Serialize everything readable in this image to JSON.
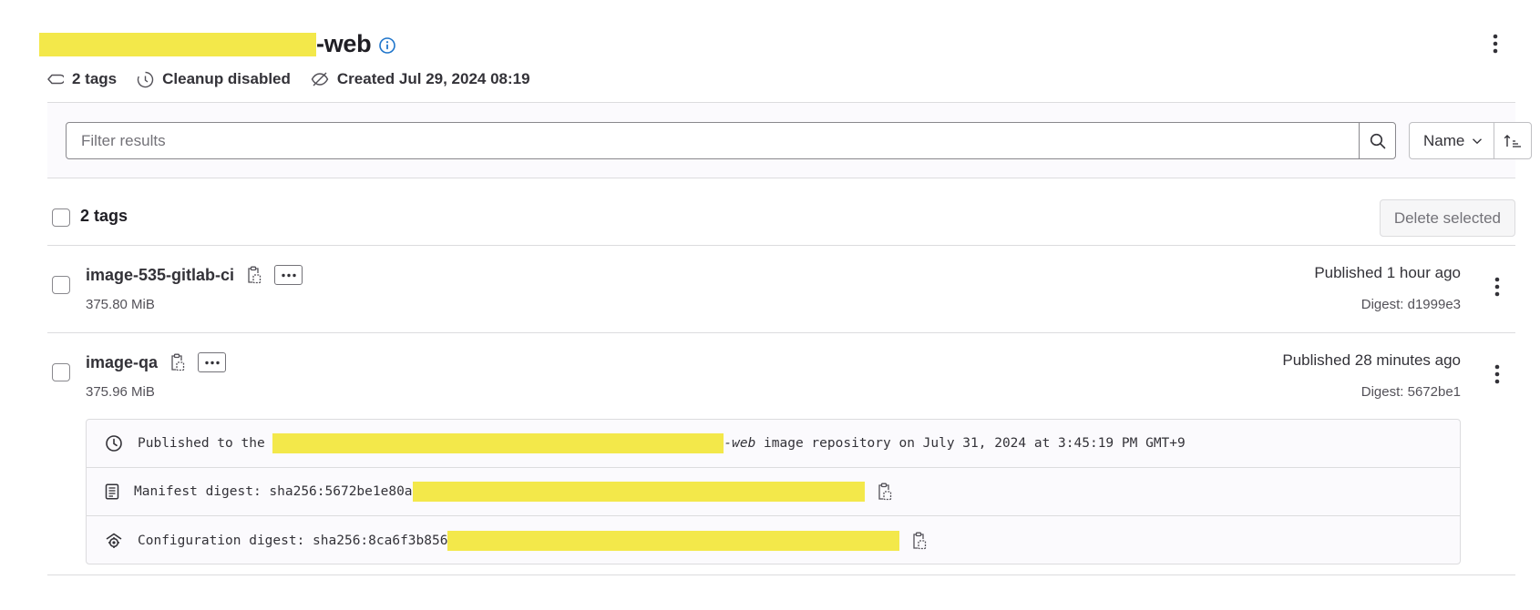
{
  "header": {
    "title_suffix": "-web",
    "meta": {
      "tags": "2 tags",
      "cleanup": "Cleanup disabled",
      "created": "Created Jul 29, 2024 08:19"
    }
  },
  "filter": {
    "placeholder": "Filter results",
    "sort_label": "Name"
  },
  "list": {
    "count_label": "2 tags",
    "delete_label": "Delete selected"
  },
  "tags": [
    {
      "name": "image-535-gitlab-ci",
      "size": "375.80 MiB",
      "published": "Published 1 hour ago",
      "digest": "Digest: d1999e3"
    },
    {
      "name": "image-qa",
      "size": "375.96 MiB",
      "published": "Published 28 minutes ago",
      "digest": "Digest: 5672be1",
      "details": {
        "published_prefix": "Published to the ",
        "published_repo_suffix": "-web",
        "published_rest": " image repository on July 31, 2024 at 3:45:19 PM GMT+9",
        "manifest_prefix": "Manifest digest: sha256:5672be1e80a",
        "config_prefix": "Configuration digest: sha256:8ca6f3b856"
      }
    }
  ],
  "icons": {
    "info": "info-icon",
    "tag": "label-icon",
    "cleanup": "clock-icon",
    "created": "eye-slash-icon",
    "search": "search-icon",
    "sort_dir": "sort-ascending-icon",
    "copy": "clipboard-icon",
    "more": "ellipsis-icon",
    "kebab": "kebab-icon",
    "clock": "clock-icon",
    "manifest": "document-icon",
    "config": "settings-icon"
  },
  "colors": {
    "accent": "#1f75cb",
    "redaction": "#f3e84a",
    "text": "#333238",
    "muted": "#737278"
  }
}
